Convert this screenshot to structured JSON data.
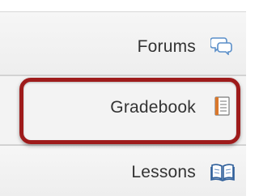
{
  "nav": {
    "items": [
      {
        "label": "Forums",
        "icon": "speech-bubbles-icon"
      },
      {
        "label": "Gradebook",
        "icon": "gradebook-icon"
      },
      {
        "label": "Lessons",
        "icon": "open-book-icon"
      }
    ],
    "highlighted_item": "Gradebook",
    "highlight_color": "#9e1b1b"
  }
}
